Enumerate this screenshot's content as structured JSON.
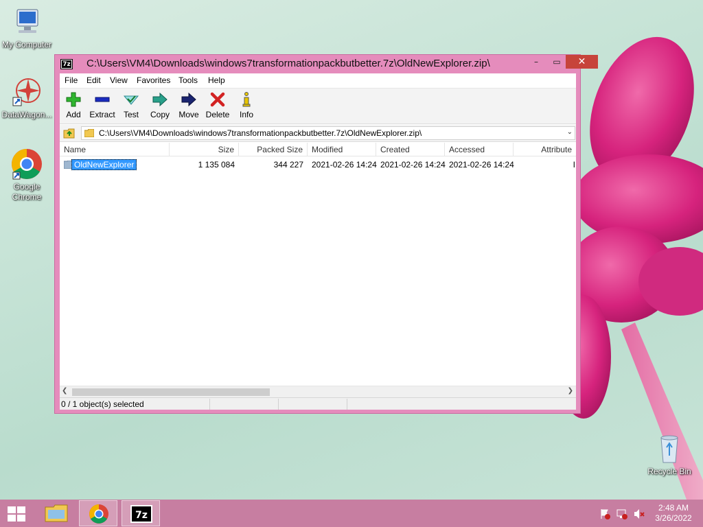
{
  "desktop": {
    "icons": [
      {
        "label": "My Computer"
      },
      {
        "label": "DataWagon..."
      },
      {
        "label": "Google Chrome"
      },
      {
        "label": "Recycle Bin"
      }
    ]
  },
  "window": {
    "app_icon_text": "7z",
    "title": "C:\\Users\\VM4\\Downloads\\windows7transformationpackbutbetter.7z\\OldNewExplorer.zip\\",
    "caption": {
      "minimize": "–",
      "maximize": "▭",
      "close": "✕"
    },
    "menu": [
      "File",
      "Edit",
      "View",
      "Favorites",
      "Tools",
      "Help"
    ],
    "toolbar": [
      {
        "label": "Add",
        "icon": "add-icon"
      },
      {
        "label": "Extract",
        "icon": "extract-icon"
      },
      {
        "label": "Test",
        "icon": "test-icon"
      },
      {
        "label": "Copy",
        "icon": "copy-icon"
      },
      {
        "label": "Move",
        "icon": "move-icon"
      },
      {
        "label": "Delete",
        "icon": "delete-icon"
      },
      {
        "label": "Info",
        "icon": "info-icon"
      }
    ],
    "address": "C:\\Users\\VM4\\Downloads\\windows7transformationpackbutbetter.7z\\OldNewExplorer.zip\\",
    "columns": [
      "Name",
      "Size",
      "Packed Size",
      "Modified",
      "Created",
      "Accessed",
      "Attribute"
    ],
    "rows": [
      {
        "name": "OldNewExplorer",
        "size": "1 135 084",
        "packed_size": "344 227",
        "modified": "2021-02-26 14:24",
        "created": "2021-02-26 14:24",
        "accessed": "2021-02-26 14:24",
        "attributes": "I"
      }
    ],
    "status": "0 / 1 object(s) selected"
  },
  "taskbar": {
    "apps": [
      "file-explorer-icon",
      "chrome-icon",
      "7zip-icon"
    ],
    "time": "2:48 AM",
    "date": "3/26/2022"
  },
  "colors": {
    "window_frame": "#e58cbc",
    "taskbar": "#c77ea1",
    "selection": "#3399ff",
    "close_button": "#c7443b"
  }
}
